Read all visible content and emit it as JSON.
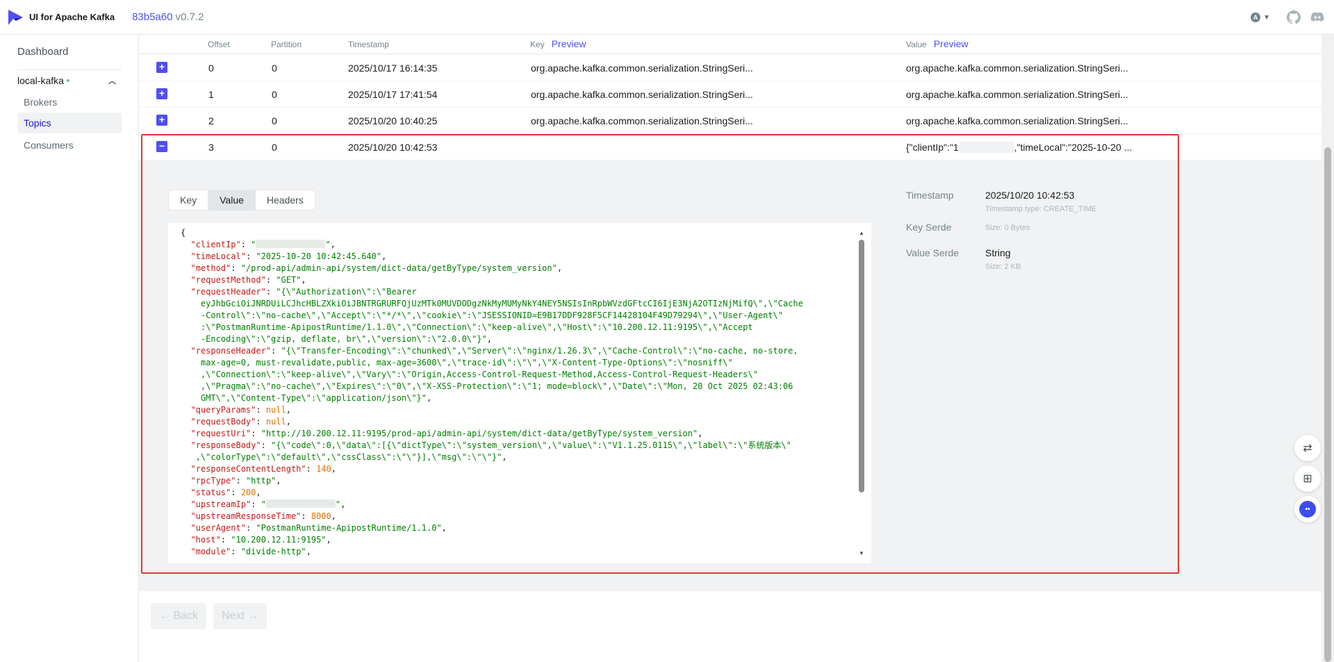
{
  "app": {
    "brand": "UI for Apache Kafka",
    "commit": "83b5a60",
    "version": "v0.7.2",
    "user_initial": "A"
  },
  "sidebar": {
    "dashboard": "Dashboard",
    "cluster": "local-kafka",
    "items": [
      {
        "label": "Brokers"
      },
      {
        "label": "Topics"
      },
      {
        "label": "Consumers"
      }
    ]
  },
  "table": {
    "headers": {
      "offset": "Offset",
      "partition": "Partition",
      "timestamp": "Timestamp",
      "key": "Key",
      "value": "Value",
      "preview": "Preview"
    },
    "rows": [
      {
        "offset": "0",
        "partition": "0",
        "timestamp": "2025/10/17 16:14:35",
        "key": "org.apache.kafka.common.serialization.StringSeri...",
        "value": "org.apache.kafka.common.serialization.StringSeri..."
      },
      {
        "offset": "1",
        "partition": "0",
        "timestamp": "2025/10/17 17:41:54",
        "key": "org.apache.kafka.common.serialization.StringSeri...",
        "value": "org.apache.kafka.common.serialization.StringSeri..."
      },
      {
        "offset": "2",
        "partition": "0",
        "timestamp": "2025/10/20 10:40:25",
        "key": "org.apache.kafka.common.serialization.StringSeri...",
        "value": "org.apache.kafka.common.serialization.StringSeri..."
      },
      {
        "offset": "3",
        "partition": "0",
        "timestamp": "2025/10/20 10:42:53",
        "key": "",
        "value_start": "{\"clientIp\":\"1",
        "value_end": ",\"timeLocal\":\"2025-10-20 ..."
      }
    ]
  },
  "detail": {
    "tabs": [
      "Key",
      "Value",
      "Headers"
    ],
    "active_tab": "Value",
    "timestamp_label": "Timestamp",
    "timestamp_value": "2025/10/20 10:42:53",
    "timestamp_type": "Timestamp type: CREATE_TIME",
    "key_serde_label": "Key Serde",
    "key_size": "Size: 0 Bytes",
    "value_serde_label": "Value Serde",
    "value_serde": "String",
    "value_size": "Size: 2 KB"
  },
  "pager": {
    "back": "← Back",
    "next": "Next →"
  }
}
